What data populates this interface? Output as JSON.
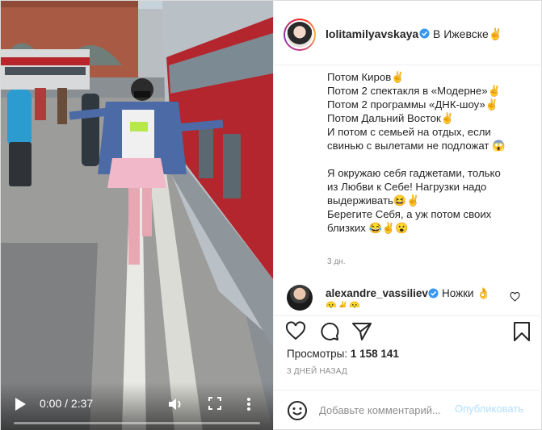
{
  "video": {
    "time_display": "0:00 / 2:37",
    "progress_fraction": 0.0,
    "icons": [
      "play-icon",
      "volume-icon",
      "fullscreen-icon",
      "more-icon"
    ]
  },
  "header": {
    "username": "lolitamilyavskaya",
    "location": "В Ижевске✌"
  },
  "caption": {
    "lines": [
      "Потом Киров✌",
      "Потом 2 спектакля в «Модерне»✌",
      "Потом 2 программы «ДНК-шоу»✌",
      "Потом Дальний Восток✌",
      "И потом с семьей на отдых, если",
      "свинью с вылетами не подложат 😱",
      "",
      "Я окружаю себя гаджетами, только",
      "из Любви к Себе! Нагрузки надо",
      "выдерживать😆✌",
      "Берегите Себя, а уж потом своих",
      "близких 😂✌😮"
    ],
    "age": "3 дн."
  },
  "comment": {
    "username": "alexandre_vassiliev",
    "text": "Ножки 👌",
    "more": "😮✌😮"
  },
  "actions": {
    "icons": [
      "heart-icon",
      "comment-icon",
      "share-icon",
      "bookmark-icon"
    ]
  },
  "stats": {
    "views_label": "Просмотры:",
    "views_value": "1 158 141",
    "date": "3 ДНЕЙ НАЗАД"
  },
  "add_comment": {
    "placeholder": "Добавьте комментарий...",
    "publish_label": "Опубликовать"
  },
  "colors": {
    "accent_blue": "#0095f6",
    "publish_disabled": "#b2dffc",
    "text_secondary": "#8e8e8e",
    "border": "#efefef"
  }
}
